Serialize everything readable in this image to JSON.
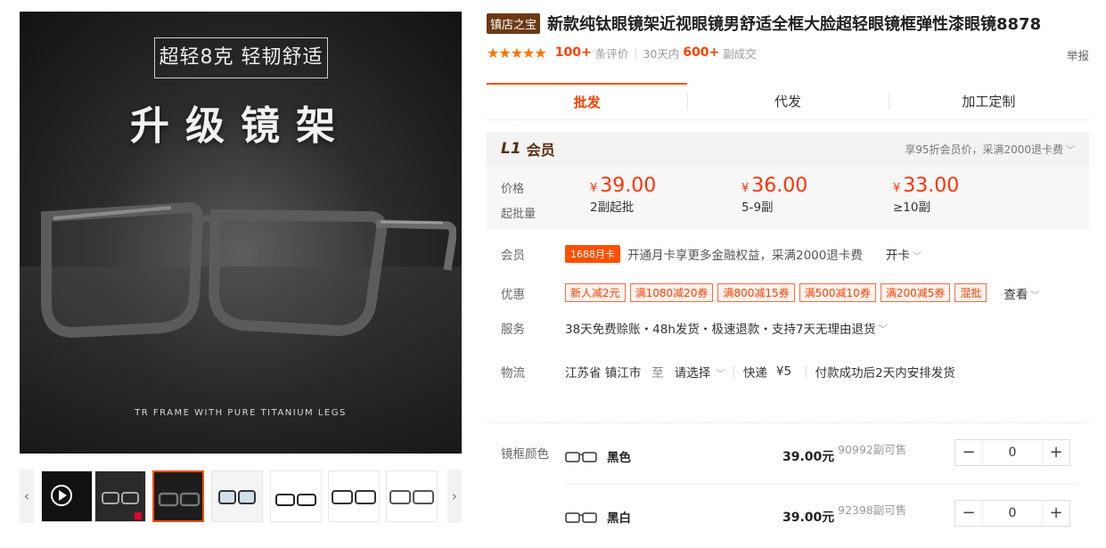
{
  "gallery": {
    "tagline": "超轻8克 轻韧舒适",
    "headline": "升级镜架",
    "caption": "TR FRAME WITH PURE TITANIUM LEGS",
    "prev_glyph": "‹",
    "next_glyph": "›",
    "thumb_count": 7,
    "active_thumb": 3
  },
  "product": {
    "store_badge": "镇店之宝",
    "title": "新款纯钛眼镜架近视眼镜男舒适全框大脸超轻眼镜框弹性漆眼镜8878",
    "stars": "★★★★★",
    "review_count": "100+",
    "review_label": "条评价",
    "deal_period": "30天内",
    "deal_count": "600+",
    "deal_label": "副成交",
    "report": "举报"
  },
  "tabs": [
    "批发",
    "代发",
    "加工定制"
  ],
  "member": {
    "level": "L1",
    "label": "会员",
    "tip": "享95折会员价，采满2000退卡费"
  },
  "pricing": {
    "price_label": "价格",
    "qty_label": "起批量",
    "currency": "¥",
    "tiers": [
      {
        "price": "39.00",
        "qty": "2副起批"
      },
      {
        "price": "36.00",
        "qty": "5-9副"
      },
      {
        "price": "33.00",
        "qty": "≥10副"
      }
    ]
  },
  "membership_row": {
    "label": "会员",
    "badge": "1688月卡",
    "text": "开通月卡享更多金融权益，采满2000退卡费",
    "action": "开卡"
  },
  "discount_row": {
    "label": "优惠",
    "coupons": [
      "新人减2元",
      "满1080减20券",
      "满800减15券",
      "满500减10券",
      "满200减5券",
      "混批"
    ],
    "more": "查看"
  },
  "service_row": {
    "label": "服务",
    "text": "38天免费赊账・48h发货・极速退款・支持7天无理由退货"
  },
  "shipping_row": {
    "label": "物流",
    "origin": "江苏省 镇江市",
    "to": "至",
    "dest": "请选择",
    "method": "快递",
    "fee": "¥5",
    "note": "付款成功后2天内安排发货"
  },
  "sku": {
    "label": "镜框颜色",
    "items": [
      {
        "name": "黑色",
        "price": "39.00元",
        "stock": "90992副可售",
        "qty": "0"
      },
      {
        "name": "黑白",
        "price": "39.00元",
        "stock": "92398副可售",
        "qty": "0"
      }
    ],
    "minus": "−",
    "plus": "+"
  },
  "colors": {
    "accent": "#ff5000",
    "price_red": "#ff3300",
    "brand_brown": "#6b3a14"
  }
}
